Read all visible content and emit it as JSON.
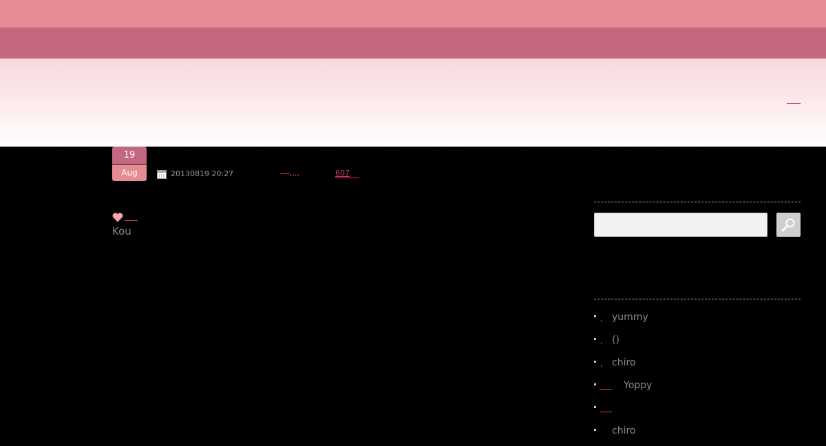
{
  "colors": {
    "topbar": "#e68a96",
    "navbar": "#c4687f",
    "link": "#d7317c",
    "background": "#000000"
  },
  "post": {
    "day": "19",
    "month": "Aug",
    "datetime": "20130819 20:27",
    "categories": ",,,,",
    "comments": "607",
    "author": "Kou"
  },
  "sidebar": {
    "search": {
      "placeholder": "",
      "button_icon": "search-icon"
    },
    "recent_comments": [
      {
        "marker": ",",
        "author": "yummy"
      },
      {
        "marker": ",",
        "author": "()"
      },
      {
        "marker": ",",
        "author": "chiro"
      },
      {
        "marker": "",
        "author": "Yoppy"
      },
      {
        "marker": "",
        "author": ""
      },
      {
        "marker": "",
        "author": "chiro"
      }
    ]
  }
}
